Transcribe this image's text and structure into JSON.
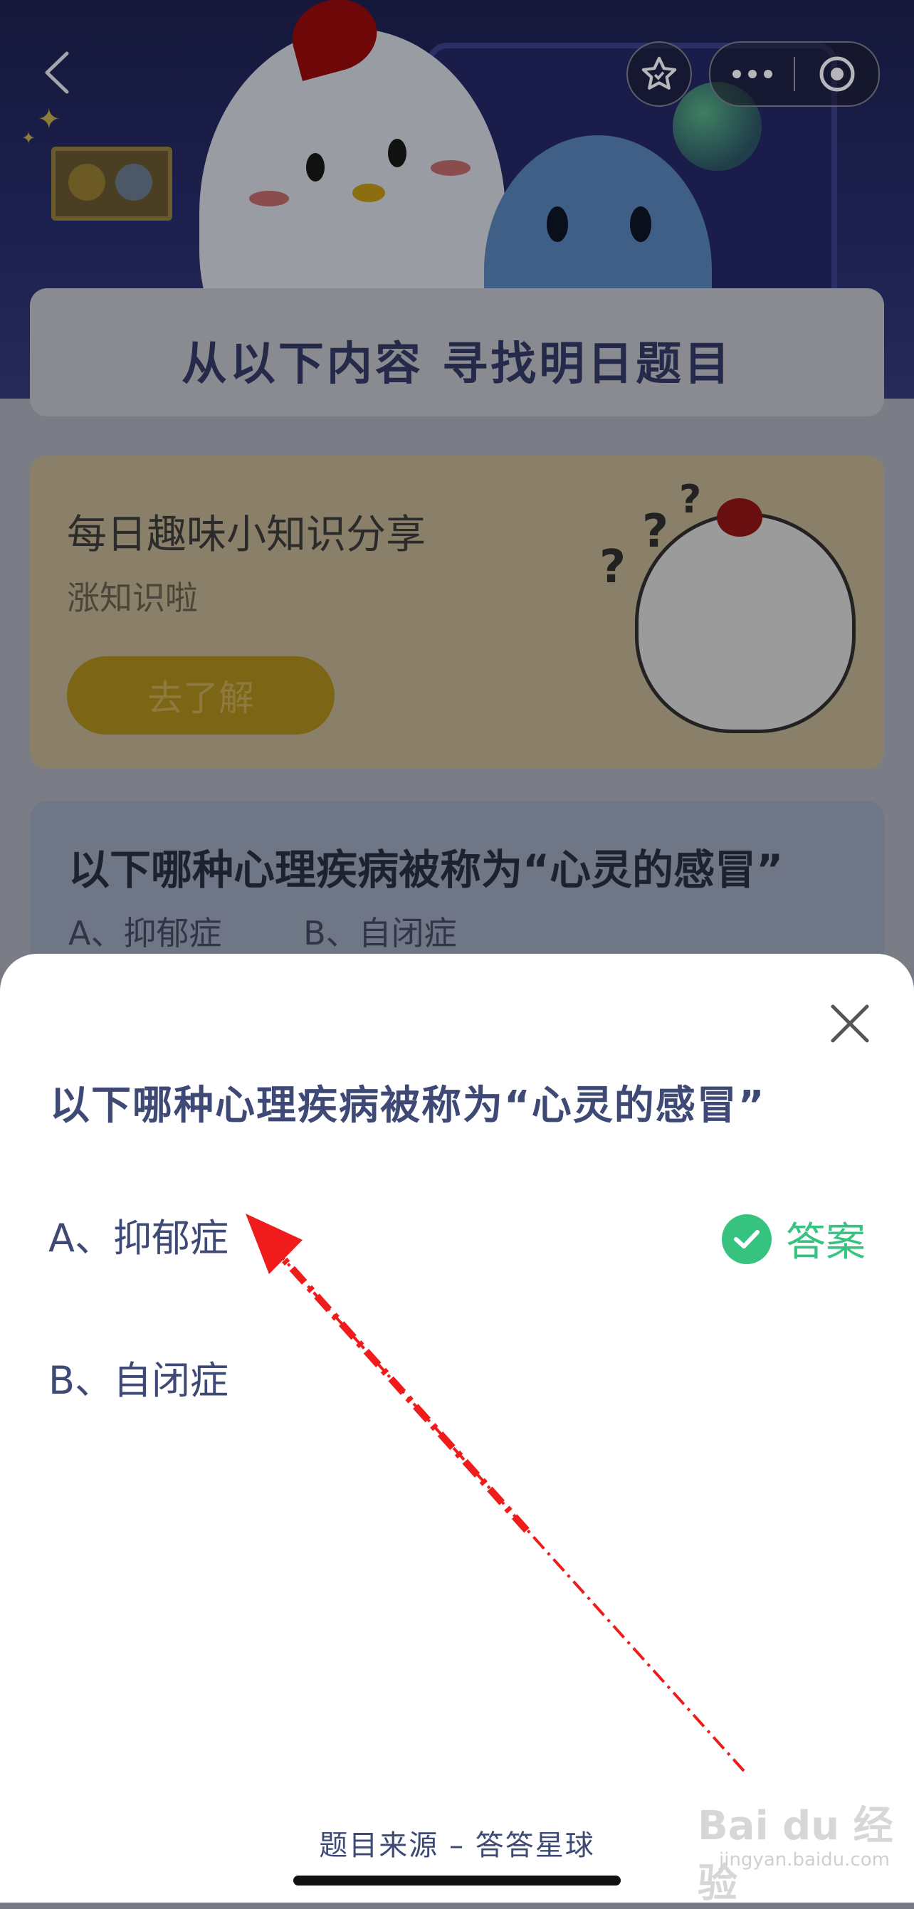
{
  "header": {
    "back_icon": "chevron-left-icon",
    "favorite_icon": "star-icon",
    "more_icon": "ellipsis-icon",
    "close_icon": "target-circle-icon"
  },
  "banner": {
    "title": "从以下内容  寻找明日题目"
  },
  "knowledge_card": {
    "title": "每日趣味小知识分享",
    "subtitle": "涨知识啦",
    "button_label": "去了解",
    "question_marks": "?",
    "question_marks_2": "?",
    "question_marks_3": "?"
  },
  "question_card": {
    "title": "以下哪种心理疾病被称为“心灵的感冒”",
    "option_a": "A、抑郁症",
    "option_b": "B、自闭症"
  },
  "sheet": {
    "title": "以下哪种心理疾病被称为“心灵的感冒”",
    "options": [
      {
        "label": "A、抑郁症",
        "is_answer": true,
        "answer_label": "答案"
      },
      {
        "label": "B、自闭症",
        "is_answer": false
      }
    ],
    "footer": "题目来源 – 答答星球"
  },
  "watermark": {
    "brand": "Bai du 经验",
    "sub": "jingyan.baidu.com"
  },
  "colors": {
    "accent_green": "#36c380",
    "title_navy": "#3e4a75",
    "annotation_red": "#f01c1c"
  }
}
